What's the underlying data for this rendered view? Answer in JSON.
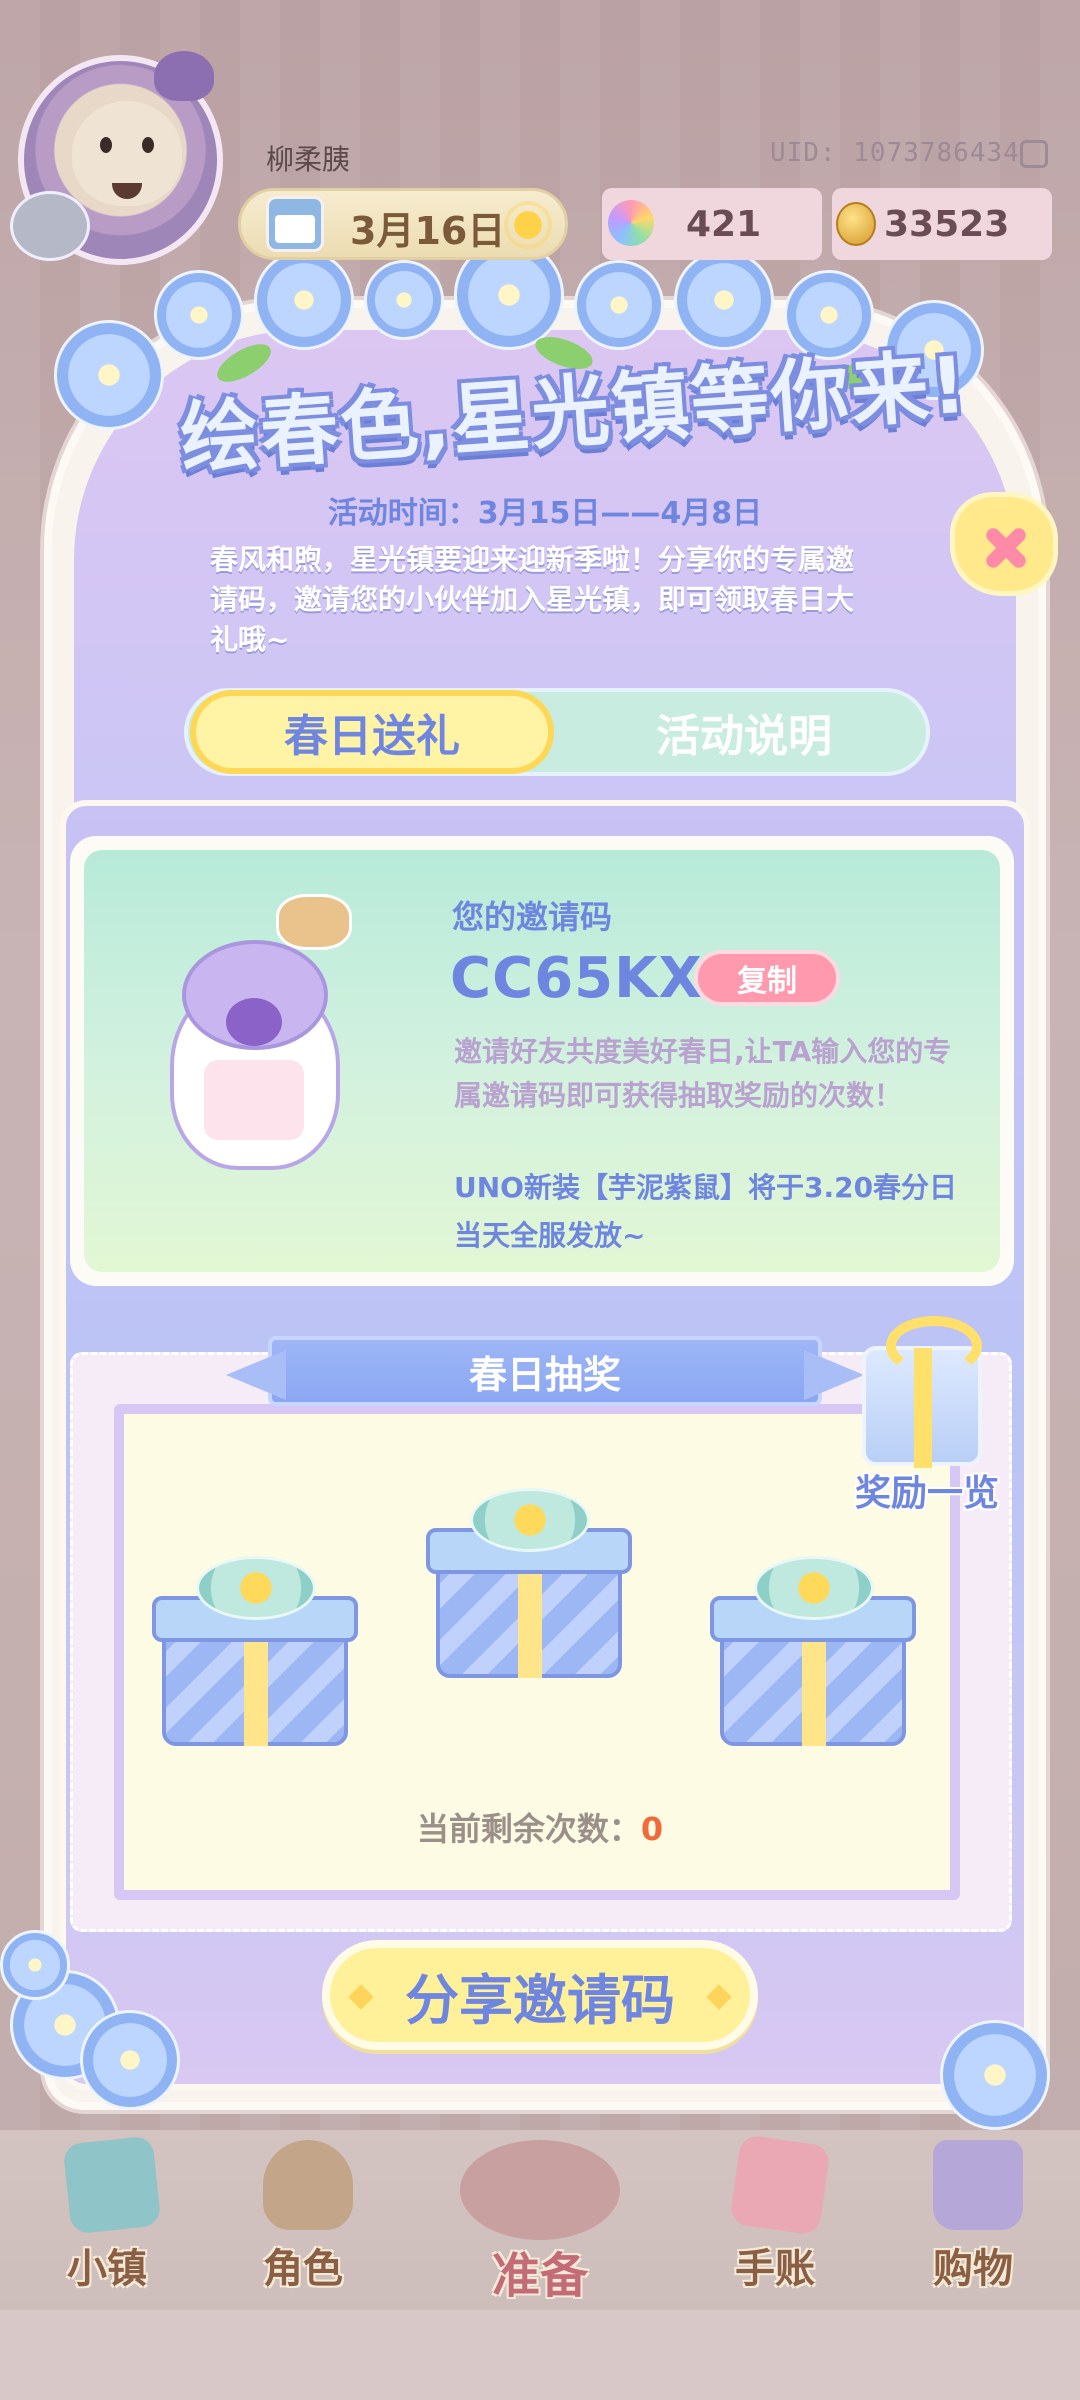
{
  "hud": {
    "player_name": "柳柔胰",
    "uid": "UID: 1073786434",
    "date": "3月16日",
    "gems": "421",
    "coins": "33523"
  },
  "popup": {
    "title": "绘春色,星光镇等你来!",
    "activity_time": "活动时间：3月15日——4月8日",
    "description": "春风和煦，星光镇要迎来迎新季啦！分享你的专属邀请码，邀请您的小伙伴加入星光镇，即可领取春日大礼哦~",
    "tabs": [
      {
        "label": "春日送礼",
        "active": true
      },
      {
        "label": "活动说明",
        "active": false
      }
    ]
  },
  "invite": {
    "label": "您的邀请码",
    "code": "CC65KX",
    "copy_label": "复制",
    "description": "邀请好友共度美好春日,让TA输入您的专属邀请码即可获得抽取奖励的次数！",
    "note": "UNO新装【芋泥紫鼠】将于3.20春分日当天全服发放~"
  },
  "lottery": {
    "title": "春日抽奖",
    "reward_list_label": "奖励一览",
    "remaining_label": "当前剩余次数：",
    "remaining_count": "0"
  },
  "share_button_label": "分享邀请码",
  "nav": [
    {
      "label": "小镇",
      "icon": "map-icon"
    },
    {
      "label": "角色",
      "icon": "character-icon"
    },
    {
      "label": "准备",
      "icon": "prepare-icon"
    },
    {
      "label": "手账",
      "icon": "journal-icon"
    },
    {
      "label": "购物",
      "icon": "shopping-bag-icon"
    }
  ],
  "colors": {
    "accent_blue": "#6f86e0",
    "tab_active_bg": "#fff3a6",
    "copy_button": "#ff9aae",
    "remaining_count": "#f06a3a"
  }
}
